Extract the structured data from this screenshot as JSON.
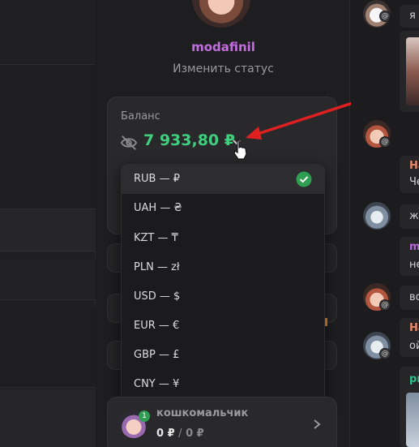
{
  "profile": {
    "username": "modafinil",
    "change_status": "Изменить статус"
  },
  "balance": {
    "label": "Баланс",
    "amount": "7 933,80 ₽"
  },
  "currency_dropdown": {
    "selected_index": 0,
    "options": [
      {
        "label": "RUB — ₽"
      },
      {
        "label": "UAH — ₴"
      },
      {
        "label": "KZT — ₸"
      },
      {
        "label": "PLN — zł"
      },
      {
        "label": "USD — $"
      },
      {
        "label": "EUR — €"
      },
      {
        "label": "GBP — £"
      },
      {
        "label": "CNY — ¥"
      }
    ]
  },
  "kitty": {
    "name": "кошкомальчик",
    "badge_count": "1",
    "balance_left": "0 ₽",
    "separator": "/",
    "balance_right": "0 ₽"
  },
  "chat": {
    "at_symbol": "@",
    "messages": [
      {
        "name": "",
        "text": "я"
      },
      {
        "name": "На",
        "text": "Че"
      },
      {
        "name": "",
        "text": "жи"
      },
      {
        "name": "m",
        "text": "не"
      },
      {
        "name": "",
        "text": "во"
      },
      {
        "name": "На",
        "text": "ой"
      },
      {
        "name": "рь",
        "text": ""
      }
    ]
  },
  "colors": {
    "accent_green": "#3fcf7e",
    "username_purple": "#c36ee0",
    "annotation_red": "#e02020",
    "check_green": "#2f9e52"
  },
  "icons": [
    "eye-off-icon",
    "chevron-down-icon",
    "cursor-icon",
    "check-icon",
    "chevron-right-icon",
    "red-arrow-annotation"
  ]
}
